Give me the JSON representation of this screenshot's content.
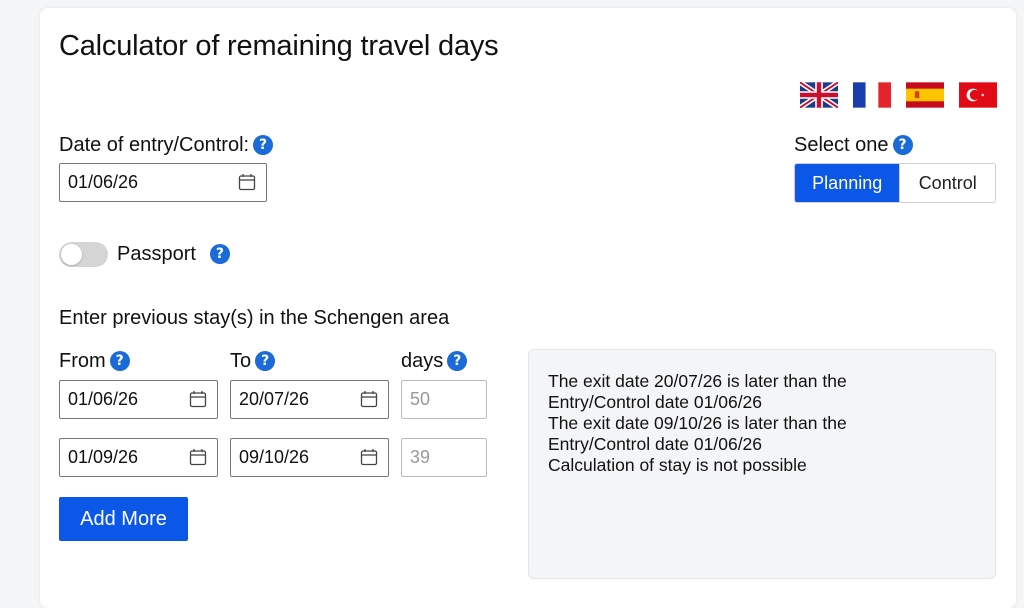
{
  "title": "Calculator of remaining travel days",
  "languages": [
    "english-flag",
    "french-flag",
    "spanish-flag",
    "turkish-flag"
  ],
  "entry": {
    "label": "Date of entry/Control:",
    "value": "01/06/26",
    "help": "?"
  },
  "mode": {
    "label": "Select one",
    "help": "?",
    "options": [
      "Planning",
      "Control"
    ],
    "selected": "Planning"
  },
  "passport": {
    "label": "Passport",
    "help": "?",
    "enabled": false
  },
  "stays": {
    "heading": "Enter previous stay(s) in the Schengen area",
    "col_from": "From",
    "col_to": "To",
    "col_days": "days",
    "help": "?",
    "rows": [
      {
        "from": "01/06/26",
        "to": "20/07/26",
        "days": "50"
      },
      {
        "from": "01/09/26",
        "to": "09/10/26",
        "days": "39"
      }
    ],
    "add_label": "Add More"
  },
  "messages": [
    "The exit date 20/07/26 is later than the",
    "Entry/Control date 01/06/26",
    "The exit date 09/10/26 is later than the",
    "Entry/Control date 01/06/26",
    "Calculation of stay is not possible"
  ],
  "colors": {
    "accent": "#0a57e8",
    "help": "#1a6ad8"
  }
}
